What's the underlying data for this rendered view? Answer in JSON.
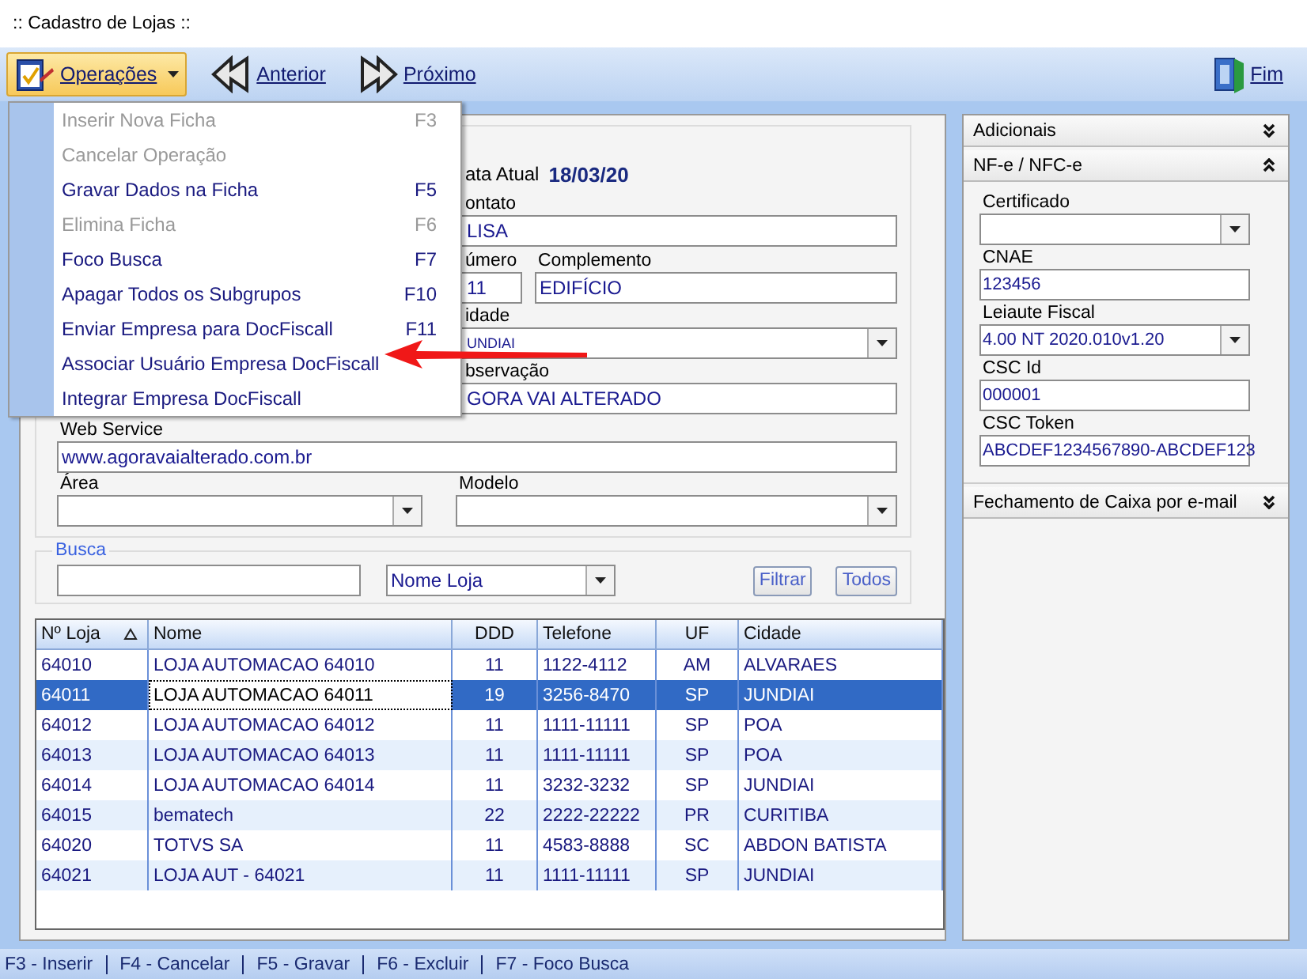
{
  "window": {
    "title": ":: Cadastro de Lojas ::"
  },
  "toolbar": {
    "items": [
      {
        "label": "Operações",
        "kind": "menu",
        "active": true
      },
      {
        "label": "Anterior",
        "kind": "back",
        "active": false
      },
      {
        "label": "Próximo",
        "kind": "forward",
        "active": false
      }
    ],
    "end": {
      "label": "Fim",
      "kind": "exit"
    }
  },
  "menu": [
    {
      "label": "Inserir Nova Ficha",
      "shortcut": "F3",
      "disabled": true
    },
    {
      "label": "Cancelar Operação",
      "disabled": true
    },
    {
      "label": "Gravar Dados na Ficha",
      "shortcut": "F5",
      "disabled": false
    },
    {
      "label": "Elimina Ficha",
      "shortcut": "F6",
      "disabled": true
    },
    {
      "label": "Foco Busca",
      "shortcut": "F7",
      "disabled": false
    },
    {
      "label": "Apagar Todos os Subgrupos",
      "shortcut": "F10",
      "disabled": false
    },
    {
      "label": "Enviar Empresa para DocFiscall",
      "shortcut": "F11",
      "disabled": false
    },
    {
      "label": "Associar Usuário Empresa DocFiscall",
      "disabled": false
    },
    {
      "label": "Integrar Empresa DocFiscall",
      "disabled": false
    }
  ],
  "form": {
    "date_label": "ata Atual",
    "date_value": "18/03/20",
    "fields": [
      {
        "label": "ontato",
        "value": "LISA",
        "kind": "text"
      },
      {
        "label": "úmero",
        "value": "11",
        "kind": "text"
      },
      {
        "label": "Complemento",
        "value": "EDIFÍCIO",
        "kind": "text"
      },
      {
        "label": "idade",
        "value": "UNDIAI",
        "kind": "select"
      },
      {
        "label": "bservação",
        "value": "GORA VAI ALTERADO",
        "kind": "text"
      },
      {
        "label": "Web Service",
        "value": "www.agoravaialterado.com.br",
        "kind": "text"
      },
      {
        "label": "Área",
        "kind": "select"
      },
      {
        "label": "Modelo",
        "kind": "select"
      }
    ]
  },
  "search": {
    "legend": "Busca",
    "filter": "Nome Loja",
    "buttons": [
      "Filtrar",
      "Todos"
    ]
  },
  "table": {
    "columns": [
      {
        "label": "Nº Loja",
        "sorted": true,
        "cursor": false
      },
      {
        "label": "Nome",
        "sorted": false,
        "cursor": true
      },
      {
        "label": "DDD",
        "sorted": false,
        "cursor": false
      },
      {
        "label": "Telefone",
        "sorted": false,
        "cursor": false
      },
      {
        "label": "UF",
        "sorted": false,
        "cursor": false
      },
      {
        "label": "Cidade",
        "sorted": false,
        "cursor": false
      }
    ],
    "rows": [
      {
        "cells": [
          "64010",
          "LOJA AUTOMACAO 64010",
          "11",
          "1122-4112",
          "AM",
          "ALVARAES"
        ],
        "selected": false
      },
      {
        "cells": [
          "64011",
          "LOJA AUTOMACAO 64011",
          "19",
          "3256-8470",
          "SP",
          "JUNDIAI"
        ],
        "selected": true
      },
      {
        "cells": [
          "64012",
          "LOJA AUTOMACAO 64012",
          "11",
          "1111-11111",
          "SP",
          "POA"
        ],
        "selected": false
      },
      {
        "cells": [
          "64013",
          "LOJA AUTOMACAO 64013",
          "11",
          "1111-11111",
          "SP",
          "POA"
        ],
        "selected": false
      },
      {
        "cells": [
          "64014",
          "LOJA AUTOMACAO 64014",
          "11",
          "3232-3232",
          "SP",
          "JUNDIAI"
        ],
        "selected": false
      },
      {
        "cells": [
          "64015",
          "bematech",
          "22",
          "2222-22222",
          "PR",
          "CURITIBA"
        ],
        "selected": false
      },
      {
        "cells": [
          "64020",
          "TOTVS SA",
          "11",
          "4583-8888",
          "SC",
          "ABDON BATISTA"
        ],
        "selected": false
      },
      {
        "cells": [
          "64021",
          "LOJA AUT - 64021",
          "11",
          "1111-11111",
          "SP",
          "JUNDIAI"
        ],
        "selected": false
      }
    ]
  },
  "side_panel": {
    "sections": [
      {
        "title": "Adicionais",
        "expanded": false
      },
      {
        "title": "NF-e / NFC-e",
        "expanded": true,
        "fields": [
          {
            "label": "Certificado",
            "kind": "select"
          },
          {
            "label": "CNAE",
            "value": "123456",
            "kind": "text"
          },
          {
            "label": "Leiaute Fiscal",
            "value": "4.00 NT 2020.010v1.20",
            "kind": "select"
          },
          {
            "label": "CSC Id",
            "value": "000001",
            "kind": "text"
          },
          {
            "label": "CSC Token",
            "value": "ABCDEF1234567890-ABCDEF123",
            "kind": "text"
          }
        ]
      },
      {
        "title": "Fechamento de Caixa por e-mail",
        "expanded": false
      }
    ]
  },
  "status_bar": [
    "F3 - Inserir",
    "F4 - Cancelar",
    "F5 - Gravar",
    "F6 - Excluir",
    "F7 - Foco Busca"
  ]
}
